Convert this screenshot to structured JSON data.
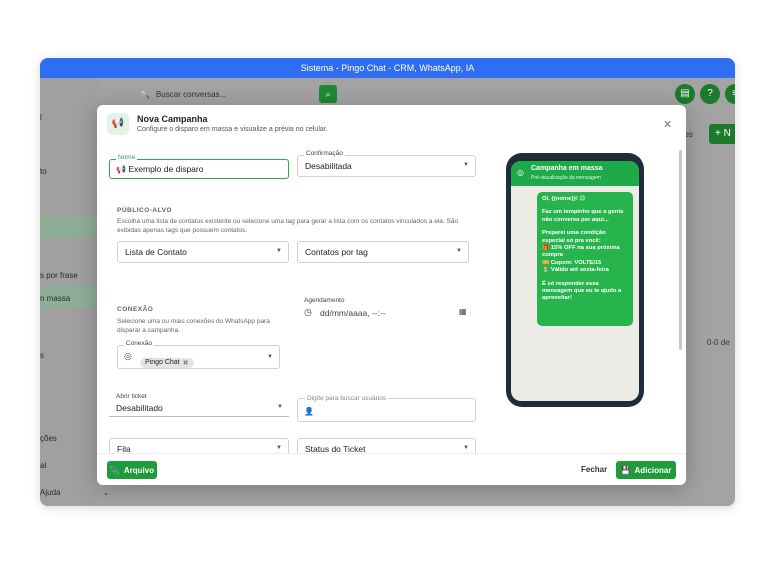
{
  "window": {
    "title": "Sistema - Pingo Chat - CRM, WhatsApp, IA"
  },
  "background": {
    "search_placeholder": "Buscar conversas...",
    "sidebar_items": [
      "l",
      "to",
      "s por frase",
      "n massa",
      "s",
      "ções",
      "al",
      "Ajuda"
    ],
    "right_text_1": "ões",
    "right_text_2": "0-0 de",
    "right_button": "+ N"
  },
  "modal": {
    "title": "Nova Campanha",
    "subtitle": "Configure o disparo em massa e visualize a prévia no celular.",
    "nome": {
      "label": "Nome",
      "value": "Exemplo de disparo"
    },
    "confirmacao": {
      "label": "Confirmação",
      "value": "Desabilitada"
    },
    "publico_alvo": {
      "title": "PÚBLICO-ALVO",
      "desc": "Escolha uma lista de contatos existente ou selecione uma tag para gerar a lista com os contatos vinculados a ela. São exibidas apenas tags que possuem contatos.",
      "lista_contato": "Lista de Contato",
      "contatos_tag": "Contatos por tag"
    },
    "conexao": {
      "title": "CONEXÃO",
      "desc": "Selecione uma ou mais conexões do WhatsApp para disparar a campanha.",
      "label": "Conexão",
      "chip": "Pingo Chat"
    },
    "agendamento": {
      "label": "Agendamento",
      "value": "dd/mm/aaaa, --:--"
    },
    "abrir_ticket": {
      "label": "Abrir ticket",
      "value": "Desabilitado"
    },
    "buscar_usuarios": {
      "placeholder": "Digite para buscar usuários"
    },
    "fila": {
      "value": "Fila"
    },
    "status_ticket": {
      "value": "Status do Ticket"
    },
    "footer": {
      "arquivo": "Arquivo",
      "fechar": "Fechar",
      "adicionar": "Adicionar"
    }
  },
  "phone": {
    "header_title": "Campanha em massa",
    "header_sub": "Pré-visualização da mensagem",
    "message_lines": [
      "Oi, {{nome}}! 😊",
      "Faz um tempinho que a gente não conversa por aqui...",
      "Preparei uma condição especial só pra você:",
      "🎁 15% OFF na sua próxima compra",
      "🎫 Cupom: VOLTEI15",
      "⏳ Válido até sexta-feira",
      "É só responder essa mensagem que eu te ajudo a aproveitar!"
    ]
  },
  "colors": {
    "accent": "#1f9b3a",
    "titlebar": "#2f6ef2",
    "phone_header": "#1faa4a"
  }
}
